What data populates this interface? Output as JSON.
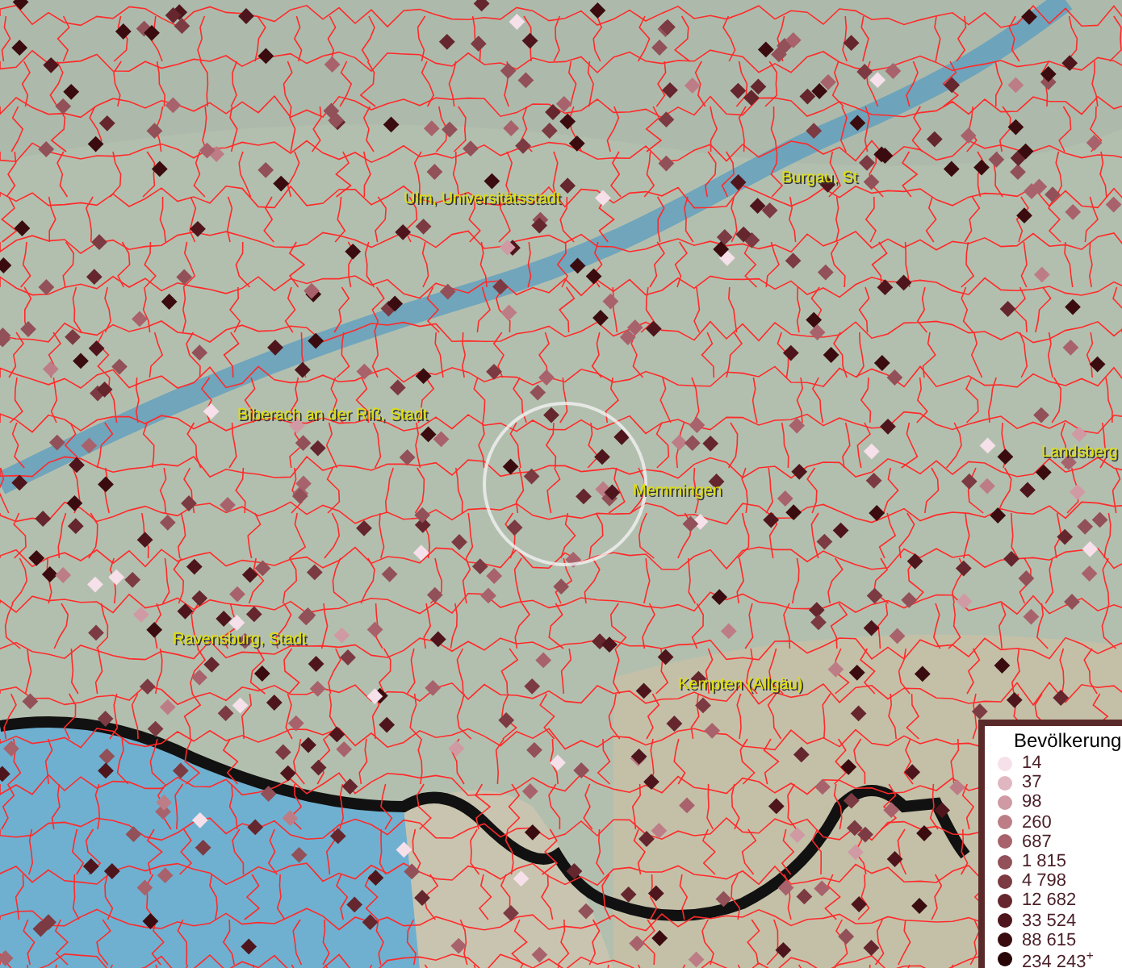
{
  "map": {
    "place_labels": [
      {
        "text": "Ulm, Universitätsstadt"
      },
      {
        "text": "Burgau, St"
      },
      {
        "text": "Biberach an der Riß, Stadt"
      },
      {
        "text": "Memmingen"
      },
      {
        "text": "Landsberg"
      },
      {
        "text": "Ravensburg, Stadt"
      },
      {
        "text": "Kempten (Allgäu)"
      }
    ]
  },
  "legend": {
    "title": "Bevölkerung",
    "items": [
      {
        "label": "14",
        "color": "#f6e0ea"
      },
      {
        "label": "37",
        "color": "#e0b6c0"
      },
      {
        "label": "98",
        "color": "#cf9aa3"
      },
      {
        "label": "260",
        "color": "#bd7d86"
      },
      {
        "label": "687",
        "color": "#a8626b"
      },
      {
        "label": "1 815",
        "color": "#925058"
      },
      {
        "label": "4 798",
        "color": "#7c3a42"
      },
      {
        "label": "12 682",
        "color": "#65262e"
      },
      {
        "label": "33 524",
        "color": "#4e161c"
      },
      {
        "label": "88 615",
        "color": "#3a0c10"
      },
      {
        "label": "234 243$^{+}$",
        "color": "#280507"
      }
    ]
  }
}
